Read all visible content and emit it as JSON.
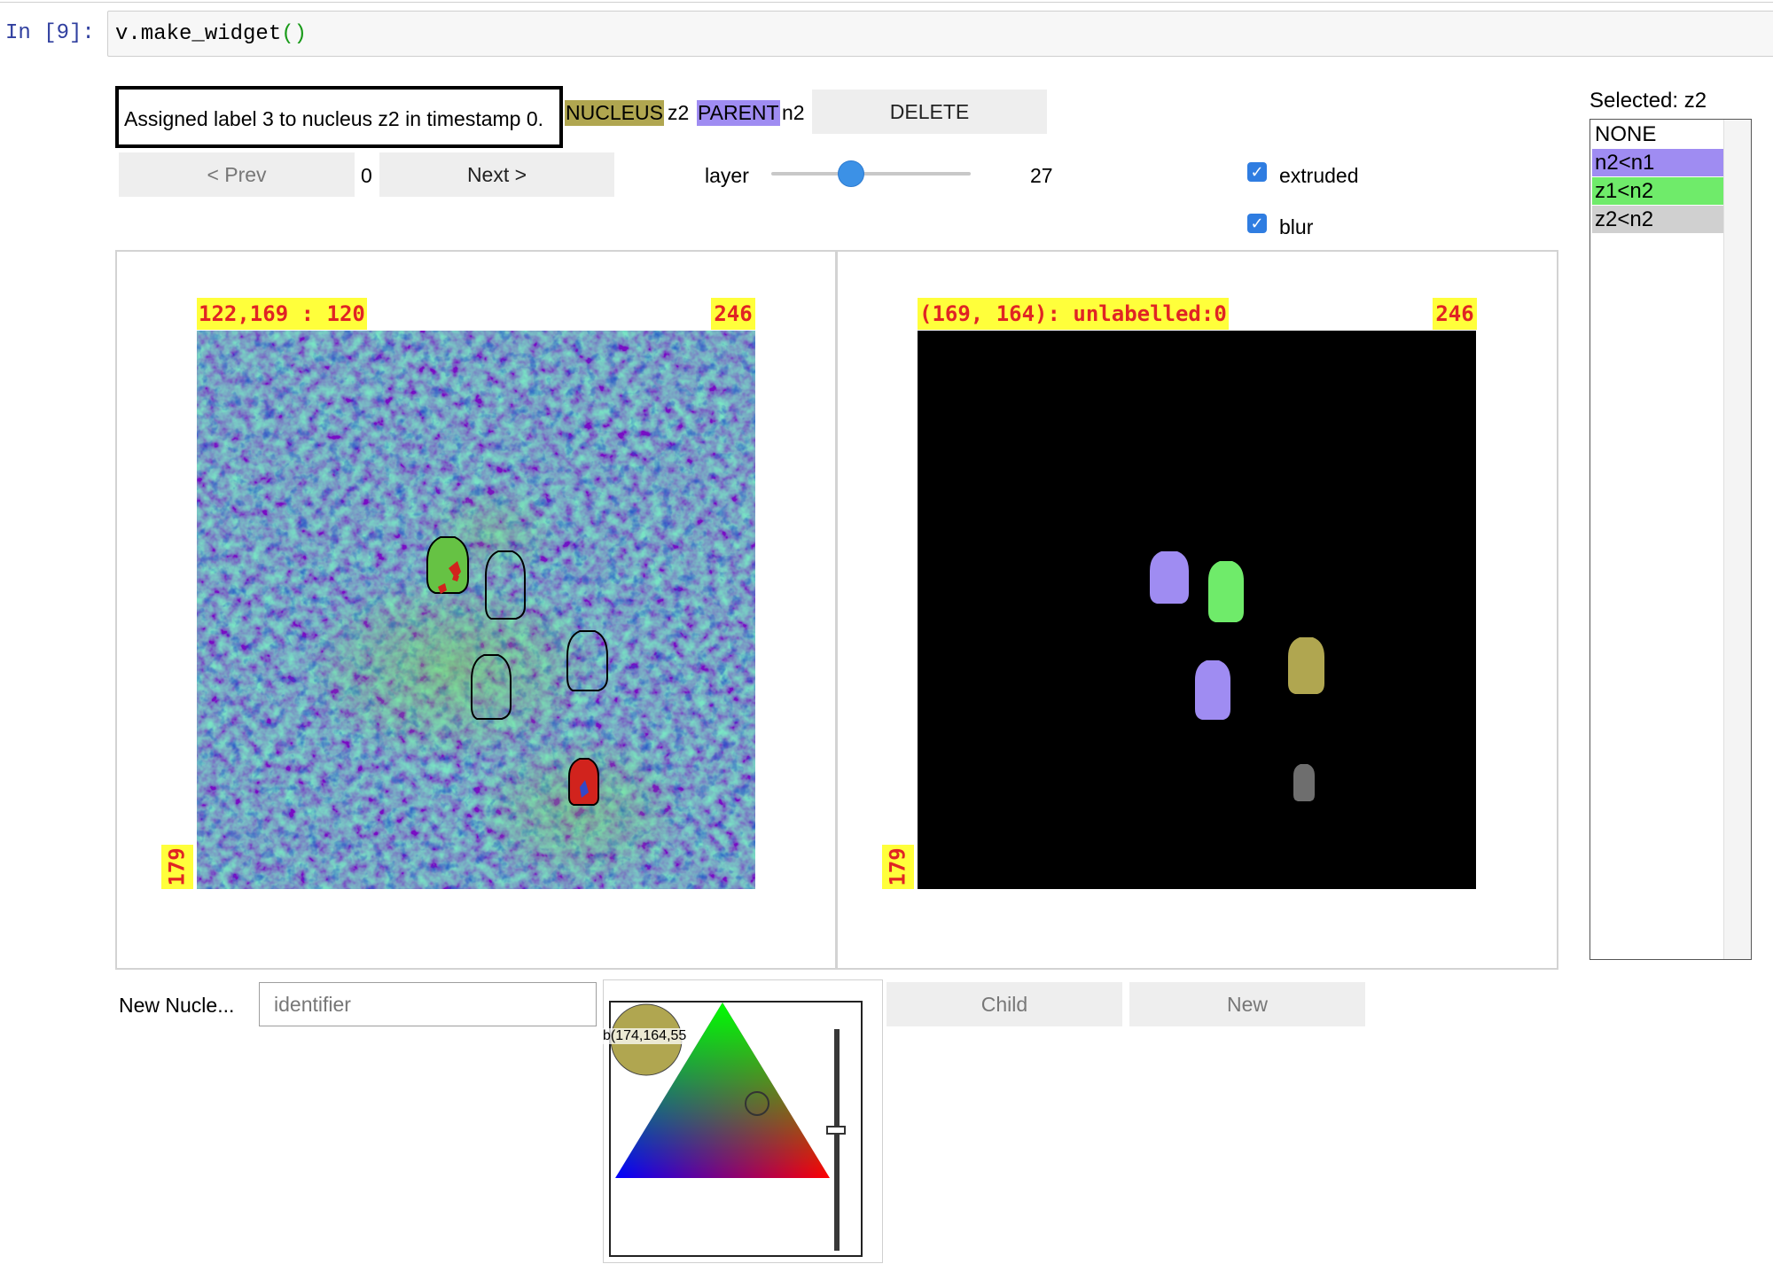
{
  "cell": {
    "prompt": "In [9]:",
    "code_text": "v.make_widget",
    "code_parens": "()"
  },
  "status_message": "Assigned label 3 to nucleus z2 in timestamp 0.",
  "nucleus_tag": "NUCLEUS",
  "nucleus_value": "z2",
  "parent_tag": "PARENT",
  "parent_value": "n2",
  "delete_label": "DELETE",
  "nav": {
    "prev_label": "< Prev",
    "timestamp": "0",
    "next_label": "Next >"
  },
  "layer_slider": {
    "label": "layer",
    "value": "27",
    "fraction": 0.4
  },
  "checkboxes": [
    {
      "label": "extruded",
      "checked": true
    },
    {
      "label": "blur",
      "checked": true
    }
  ],
  "left_panel": {
    "top_left_label": "122,169 : 120",
    "top_right_label": "246",
    "side_label": "179"
  },
  "right_panel": {
    "top_left_label": "(169, 164): unlabelled:0",
    "top_right_label": "246",
    "side_label": "179"
  },
  "selection": {
    "title": "Selected: z2",
    "options": [
      {
        "label": "NONE",
        "color": "#ffffff"
      },
      {
        "label": "n2<n1",
        "color": "#9f8cf2"
      },
      {
        "label": "z1<n2",
        "color": "#6feb6a"
      },
      {
        "label": "z2<n2",
        "color": "#d0d0d0"
      }
    ]
  },
  "new_nucleus": {
    "label": "New Nucle...",
    "placeholder": "identifier",
    "child_label": "Child",
    "new_label": "New"
  },
  "color_picker": {
    "readout": "b(174,164,55",
    "swatch_color": "#b0a650"
  },
  "colors": {
    "nucleus_highlight": "#b0a650",
    "parent_highlight": "#9f8cf2",
    "label_background": "#ffff3b",
    "label_text": "#e02424",
    "slider_thumb": "#3c91e6"
  }
}
